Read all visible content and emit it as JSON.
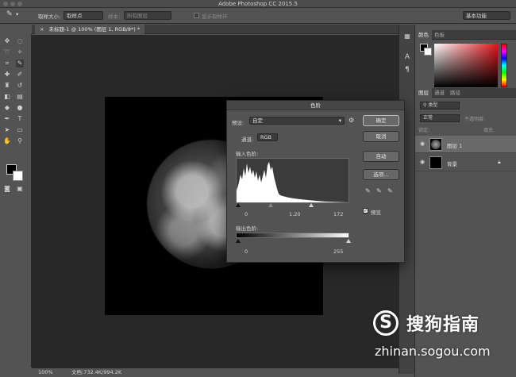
{
  "app": {
    "title": "Adobe Photoshop CC 2015.5"
  },
  "options_bar": {
    "sample_size_label": "取样大小:",
    "sample_size_value": "取样点",
    "sample_label": "样本:",
    "sample_value": "所有图层",
    "show_ring_label": "显示取样环",
    "workspace": "基本功能"
  },
  "document": {
    "tab_label": "未标题-1 @ 100% (图层 1, RGB/8*) *"
  },
  "status": {
    "zoom": "100%",
    "doc_info": "文档:732.4K/994.2K"
  },
  "color_panel": {
    "tabs": [
      "颜色",
      "色板"
    ],
    "accent": "#e0161c"
  },
  "layers_panel": {
    "tabs": [
      "图层",
      "通道",
      "路径"
    ],
    "filter": "类型",
    "blend_mode": "正常",
    "opacity_label": "不透明度:",
    "lock_label": "锁定:",
    "fill_label": "填充:",
    "layers": [
      {
        "name": "图层 1",
        "selected": true
      },
      {
        "name": "背景",
        "selected": false
      }
    ]
  },
  "levels_dialog": {
    "title": "色阶",
    "preset_label": "预设:",
    "preset_value": "自定",
    "channel_label": "通道:",
    "channel_value": "RGB",
    "input_label": "输入色阶:",
    "input_values": [
      "0",
      "1.20",
      "172"
    ],
    "output_label": "输出色阶:",
    "output_values": [
      "0",
      "255"
    ],
    "buttons": {
      "ok": "确定",
      "cancel": "取消",
      "auto": "自动",
      "options": "选项..."
    },
    "preview_label": "预览",
    "preview_checked": true
  },
  "watermark": {
    "logo_letter": "S",
    "brand": "搜狗指南",
    "url": "zhinan.sogou.com"
  }
}
